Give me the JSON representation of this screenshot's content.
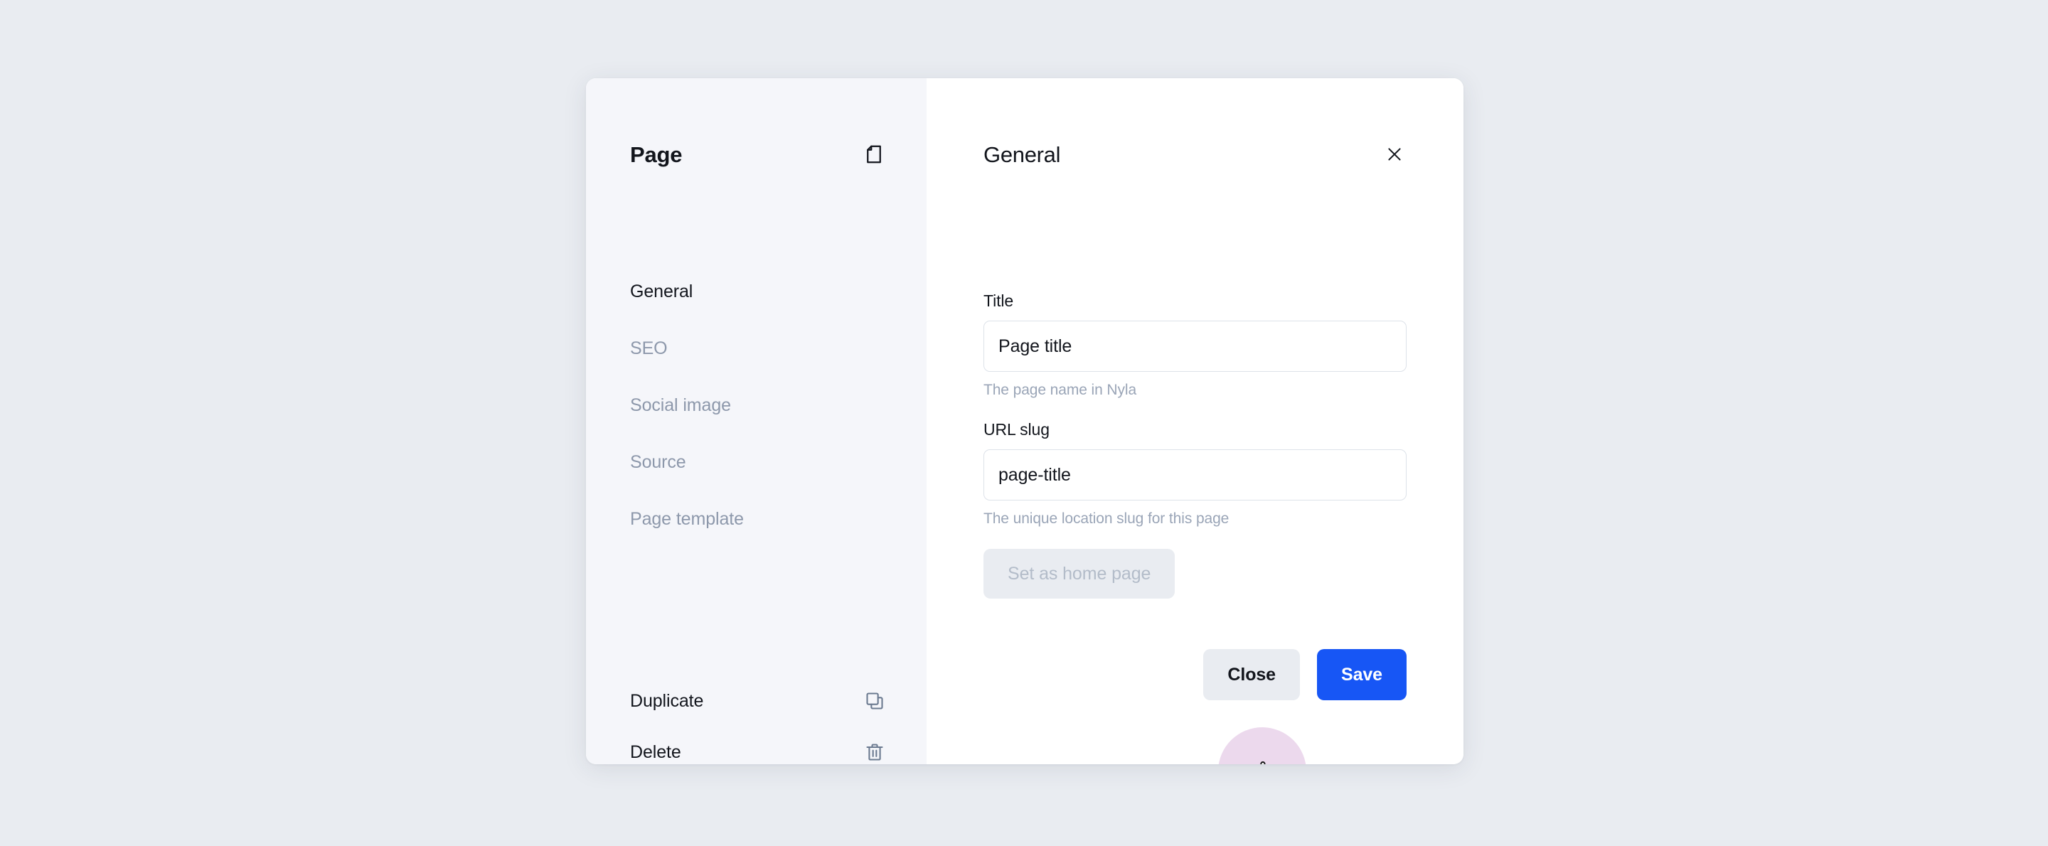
{
  "modal": {
    "sidebar": {
      "title": "Page",
      "header_icon": "document-icon",
      "items": [
        {
          "label": "General",
          "active": true
        },
        {
          "label": "SEO",
          "active": false
        },
        {
          "label": "Social image",
          "active": false
        },
        {
          "label": "Source",
          "active": false
        },
        {
          "label": "Page template",
          "active": false
        }
      ],
      "actions": [
        {
          "label": "Duplicate",
          "icon": "copy-icon"
        },
        {
          "label": "Delete",
          "icon": "trash-icon"
        }
      ]
    },
    "main": {
      "title": "General",
      "close_icon": "close-icon",
      "fields": [
        {
          "label": "Title",
          "value": "Page title",
          "placeholder": "Page title",
          "help": "The page name in Nyla"
        },
        {
          "label": "URL slug",
          "value": "page-title",
          "placeholder": "page-title",
          "help": "The unique location slug for this page"
        }
      ],
      "home_page_button": "Set as home page",
      "footer": {
        "close_label": "Close",
        "save_label": "Save"
      }
    }
  },
  "cursor": {
    "icon": "pointer-hand-cursor",
    "highlight_color": "#ecd9ed"
  },
  "colors": {
    "page_background": "#e9ecf1",
    "sidebar_background": "#f5f6fa",
    "panel_background": "#ffffff",
    "primary_accent": "#1756f5",
    "muted_text": "#8d98ab",
    "body_text": "#12151c",
    "input_border": "#dde2e9"
  }
}
